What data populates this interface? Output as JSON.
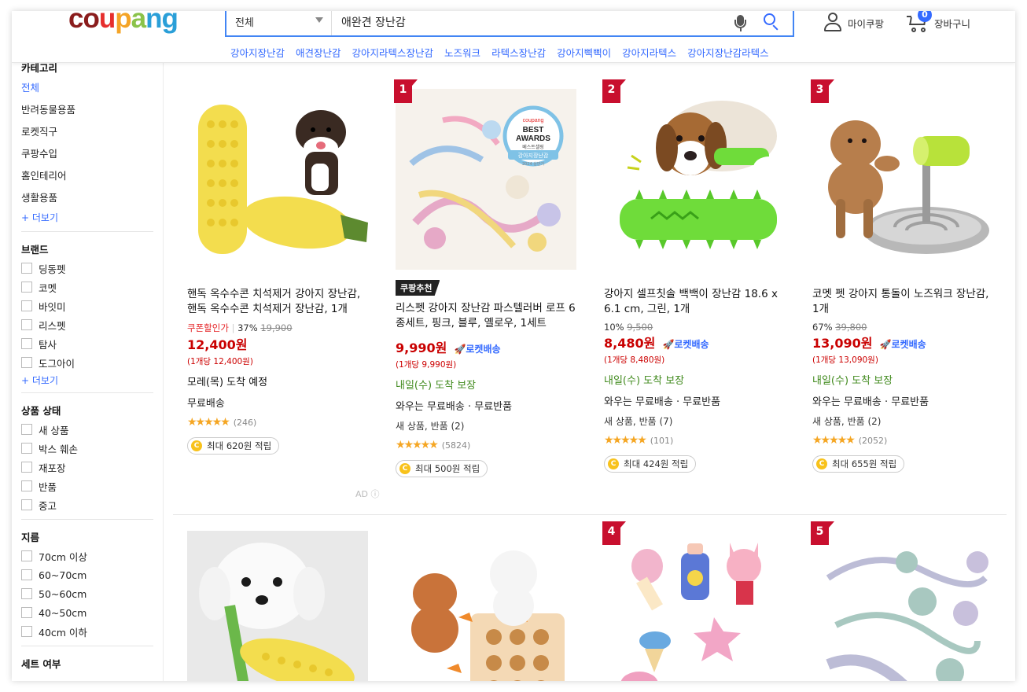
{
  "header": {
    "logo": "coupang",
    "search_category": "전체",
    "search_query": "애완견 장난감",
    "keywords": [
      "강아지장난감",
      "애견장난감",
      "강아지라텍스장난감",
      "노즈워크",
      "라텍스장난감",
      "강아지삑삑이",
      "강아지라텍스",
      "강아지장난감라텍스"
    ],
    "mypage_label": "마이쿠팡",
    "cart_label": "장바구니",
    "cart_count": "0"
  },
  "sidebar": {
    "category_title": "카테고리",
    "categories": [
      "전체",
      "반려동물용품",
      "로켓직구",
      "쿠팡수입",
      "홈인테리어",
      "생활용품"
    ],
    "more_label": "+ 더보기",
    "brand_title": "브랜드",
    "brands": [
      "딩동펫",
      "코멧",
      "바잇미",
      "리스펫",
      "탐사",
      "도그아이"
    ],
    "condition_title": "상품 상태",
    "conditions": [
      "새 상품",
      "박스 훼손",
      "재포장",
      "반품",
      "중고"
    ],
    "size_title": "지름",
    "sizes": [
      "70cm 이상",
      "60~70cm",
      "50~60cm",
      "40~50cm",
      "40cm 이하"
    ],
    "set_title": "세트 여부"
  },
  "products": [
    {
      "rank": "",
      "badge": "",
      "name": "핸독 옥수수콘 치석제거 강아지 장난감, 핸독 옥수수콘 치석제거 장난감, 1개",
      "coupon_label": "쿠폰할인가",
      "discount": "37%",
      "original_price": "19,900",
      "price": "12,400원",
      "rocket": "",
      "unit_price": "(1개당 12,400원)",
      "delivery": "모레(목) 도착 예정",
      "shipping": "무료배송",
      "new_used": "",
      "rating_count": "(246)",
      "reward": "최대 620원 적립",
      "ad": "AD"
    },
    {
      "rank": "1",
      "badge": "쿠팡추천",
      "name": "리스펫 강아지 장난감 파스텔러버 로프 6종세트, 핑크, 블루, 옐로우, 1세트",
      "coupon_label": "",
      "discount": "",
      "original_price": "",
      "price": "9,990원",
      "rocket": "로켓배송",
      "unit_price": "(1개당 9,990원)",
      "delivery": "내일(수) 도착 보장",
      "shipping": "와우는 무료배송 · 무료반품",
      "new_used": "새 상품, 반품 (2)",
      "rating_count": "(5824)",
      "reward": "최대 500원 적립",
      "ad": ""
    },
    {
      "rank": "2",
      "badge": "",
      "name": "강아지 셀프칫솔 백백이 장난감 18.6 x 6.1 cm, 그린, 1개",
      "coupon_label": "",
      "discount": "10%",
      "original_price": "9,500",
      "price": "8,480원",
      "rocket": "로켓배송",
      "unit_price": "(1개당 8,480원)",
      "delivery": "내일(수) 도착 보장",
      "shipping": "와우는 무료배송 · 무료반품",
      "new_used": "새 상품, 반품 (7)",
      "rating_count": "(101)",
      "reward": "최대 424원 적립",
      "ad": ""
    },
    {
      "rank": "3",
      "badge": "",
      "name": "코멧 펫 강아지 통돌이 노즈워크 장난감, 1개",
      "coupon_label": "",
      "discount": "67%",
      "original_price": "39,800",
      "price": "13,090원",
      "rocket": "로켓배송",
      "unit_price": "(1개당 13,090원)",
      "delivery": "내일(수) 도착 보장",
      "shipping": "와우는 무료배송 · 무료반품",
      "new_used": "새 상품, 반품 (2)",
      "rating_count": "(2052)",
      "reward": "최대 655원 적립",
      "ad": ""
    }
  ],
  "row2_ranks": [
    "",
    "",
    "4",
    "5"
  ],
  "award": {
    "brand": "coupang",
    "line1": "BEST",
    "line2": "AWARDS",
    "line3": "베스트셀링",
    "line4": "강아지장난감",
    "line5": "2024 상반기"
  },
  "colors": {
    "accent": "#346aff",
    "price_red": "#c90000",
    "rank_red": "#c80f2e",
    "delivery_green": "#408a1d"
  }
}
